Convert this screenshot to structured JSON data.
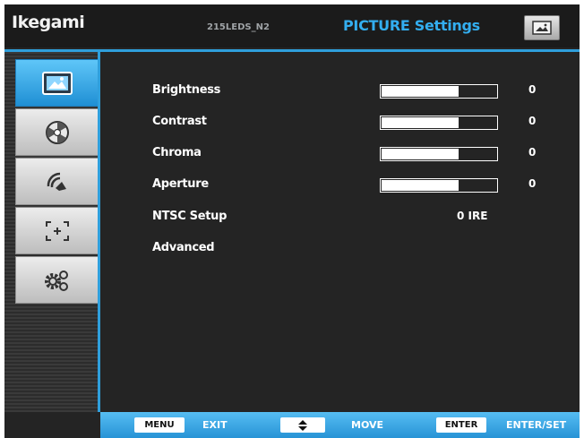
{
  "header": {
    "brand": "Ikegami",
    "model": "215LEDS_N2",
    "title": "PICTURE Settings",
    "icon": "picture-icon"
  },
  "sidebar": {
    "tabs": [
      {
        "icon": "picture-icon",
        "active": true
      },
      {
        "icon": "color-wheel-icon",
        "active": false
      },
      {
        "icon": "audio-icon",
        "active": false
      },
      {
        "icon": "marker-icon",
        "active": false
      },
      {
        "icon": "gears-icon",
        "active": false
      }
    ]
  },
  "settings": {
    "brightness": {
      "label": "Brightness",
      "value": "0",
      "level": 0.67
    },
    "contrast": {
      "label": "Contrast",
      "value": "0",
      "level": 0.67
    },
    "chroma": {
      "label": "Chroma",
      "value": "0",
      "level": 0.67
    },
    "aperture": {
      "label": "Aperture",
      "value": "0",
      "level": 0.67
    },
    "ntsc_setup": {
      "label": "NTSC Setup",
      "value": "0 IRE"
    },
    "advanced": {
      "label": "Advanced"
    }
  },
  "footer": {
    "menu_key": "MENU",
    "menu_action": "EXIT",
    "move_key_icon": "up-down-arrows-icon",
    "move_action": "MOVE",
    "enter_key": "ENTER",
    "enter_action": "ENTER/SET"
  },
  "colors": {
    "accent": "#2f9fdc",
    "title": "#33aef0",
    "background": "#242424"
  }
}
